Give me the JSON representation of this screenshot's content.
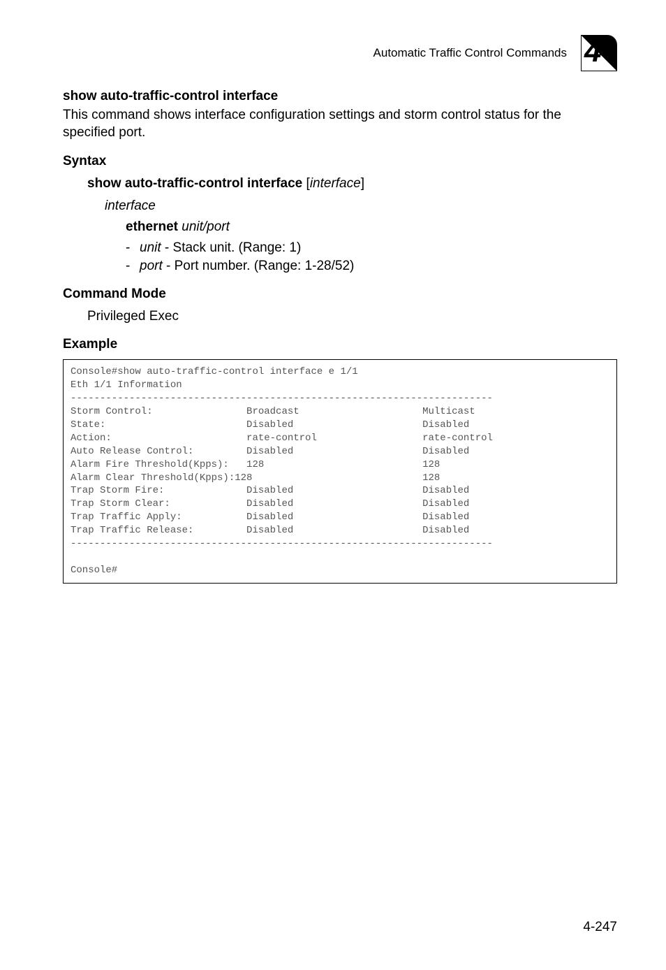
{
  "header": {
    "running_head": "Automatic Traffic Control Commands",
    "chapter_number": "4"
  },
  "section": {
    "title": "show auto-traffic-control interface",
    "description": "This command shows interface configuration settings and storm control status for the specified port."
  },
  "syntax": {
    "heading": "Syntax",
    "command_bold": "show auto-traffic-control interface",
    "command_arg": "interface",
    "interface_label": "interface",
    "ethernet_bold": "ethernet",
    "ethernet_args": "unit/port",
    "unit_label": "unit",
    "unit_desc": " - Stack unit. (Range: 1)",
    "port_label": "port",
    "port_desc": " - Port number. (Range: 1-28/52)"
  },
  "command_mode": {
    "heading": "Command Mode",
    "value": "Privileged Exec"
  },
  "example": {
    "heading": "Example",
    "code": "Console#show auto-traffic-control interface e 1/1\nEth 1/1 Information\n------------------------------------------------------------------------\nStorm Control:                Broadcast                     Multicast\nState:                        Disabled                      Disabled\nAction:                       rate-control                  rate-control\nAuto Release Control:         Disabled                      Disabled\nAlarm Fire Threshold(Kpps):   128                           128\nAlarm Clear Threshold(Kpps):128                             128\nTrap Storm Fire:              Disabled                      Disabled\nTrap Storm Clear:             Disabled                      Disabled\nTrap Traffic Apply:           Disabled                      Disabled\nTrap Traffic Release:         Disabled                      Disabled\n------------------------------------------------------------------------\n\nConsole#"
  },
  "footer": {
    "page_number": "4-247"
  }
}
